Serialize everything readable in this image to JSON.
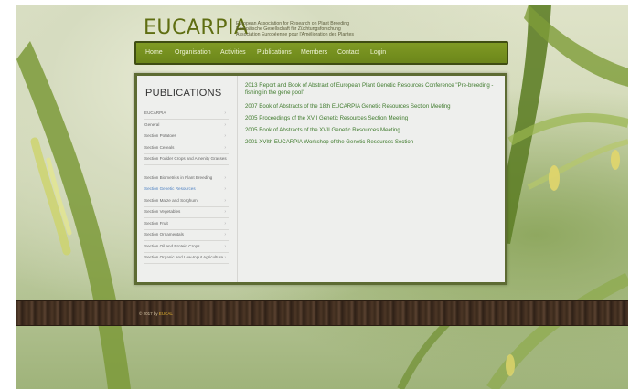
{
  "header": {
    "logo": "EUCARPIA",
    "tagline": [
      "European Association for Research on Plant Breeding",
      "Europäische Gesellschaft für Züchtungsforschung",
      "Association Européenne pour l'Amélioration des Plantes"
    ]
  },
  "nav": {
    "items": [
      "Home",
      "Organisation",
      "Activities",
      "Publications",
      "Members",
      "Contact",
      "Login"
    ]
  },
  "sidebar": {
    "title": "PUBLICATIONS",
    "items": [
      {
        "label": "EUCARPIA",
        "active": false
      },
      {
        "label": "General",
        "active": false
      },
      {
        "label": "Section Potatoes",
        "active": false
      },
      {
        "label": "Section Cereals",
        "active": false
      },
      {
        "label": "Section Fodder Crops and Amenity Grasses",
        "active": false
      },
      {
        "label": "Section Biometrics in Plant Breeding",
        "active": false
      },
      {
        "label": "Section Genetic Resources",
        "active": true
      },
      {
        "label": "Section Maize and Sorghum",
        "active": false
      },
      {
        "label": "Section Vegetables",
        "active": false
      },
      {
        "label": "Section Fruit",
        "active": false
      },
      {
        "label": "Section Ornamentals",
        "active": false
      },
      {
        "label": "Section Oil and Protein Crops",
        "active": false
      },
      {
        "label": "Section Organic and Low-Input Agriculture",
        "active": false
      }
    ]
  },
  "publications": [
    "2013 Report and Book of Abstract of European Plant Genetic Resources Conference \"Pre-breeding - fishing in the gene pool\"",
    "2007 Book of Abstracts of the 18th EUCARPIA Genetic Resources Section Meeting",
    "2005 Proceedings of the XVII Genetic Resources Section Meeting",
    "2005 Book of Abstracts of the XVII Genetic Resources Meeting",
    "2001 XVIth EUCARPIA Workshop of the Genetic Resources Section"
  ],
  "footer": {
    "copyright": "© 2017 by",
    "link": "EUCAL"
  },
  "colors": {
    "nav_bg": "#718b1e",
    "link_green": "#3e7a2c",
    "active_blue": "#4a7fc2",
    "logo_green": "#5f6e12"
  }
}
